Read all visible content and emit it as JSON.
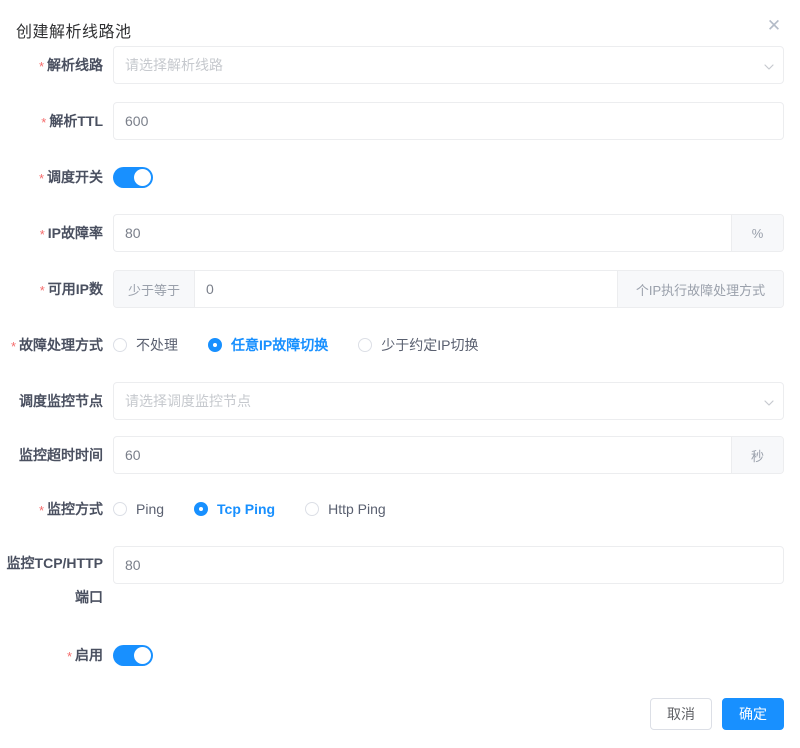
{
  "modal": {
    "title": "创建解析线路池",
    "close_icon": "close-icon",
    "close_glyph": "✕"
  },
  "form": {
    "line_pool": {
      "label": "解析线路",
      "required": true,
      "placeholder": "请选择解析线路",
      "value": "",
      "chevron_icon": "chevron-down-icon"
    },
    "ttl": {
      "label": "解析TTL",
      "required": true,
      "value": "600"
    },
    "schedule_switch": {
      "label": "调度开关",
      "required": true,
      "state": "on"
    },
    "ip_failure_rate": {
      "label": "IP故障率",
      "required": true,
      "value": "80",
      "suffix": "%"
    },
    "available_ip_count": {
      "label": "可用IP数",
      "required": true,
      "prefix": "少于等于",
      "value": "0",
      "suffix": "个IP执行故障处理方式"
    },
    "failure_handling": {
      "label": "故障处理方式",
      "required": true,
      "options": [
        {
          "label": "不处理",
          "selected": false
        },
        {
          "label": "任意IP故障切换",
          "selected": true
        },
        {
          "label": "少于约定IP切换",
          "selected": false
        }
      ]
    },
    "monitor_node": {
      "label": "调度监控节点",
      "required": false,
      "placeholder": "请选择调度监控节点",
      "value": "",
      "chevron_icon": "chevron-down-icon"
    },
    "monitor_timeout": {
      "label": "监控超时时间",
      "required": false,
      "value": "60",
      "suffix": "秒"
    },
    "monitor_method": {
      "label": "监控方式",
      "required": true,
      "options": [
        {
          "label": "Ping",
          "selected": false
        },
        {
          "label": "Tcp Ping",
          "selected": true
        },
        {
          "label": "Http Ping",
          "selected": false
        }
      ]
    },
    "monitor_port": {
      "label_line1": "监控TCP/HTTP",
      "label_line2": "端口",
      "required": false,
      "value": "80"
    },
    "enabled": {
      "label": "启用",
      "required": true,
      "state": "on"
    }
  },
  "footer": {
    "cancel_label": "取消",
    "confirm_label": "确定"
  },
  "colors": {
    "accent": "#1890ff",
    "required_star": "#f56c6c",
    "border": "#ecedef",
    "addon_bg": "#f7f8fa",
    "title": "#303133",
    "label": "#4a5060",
    "placeholder": "#c6c9ce"
  }
}
